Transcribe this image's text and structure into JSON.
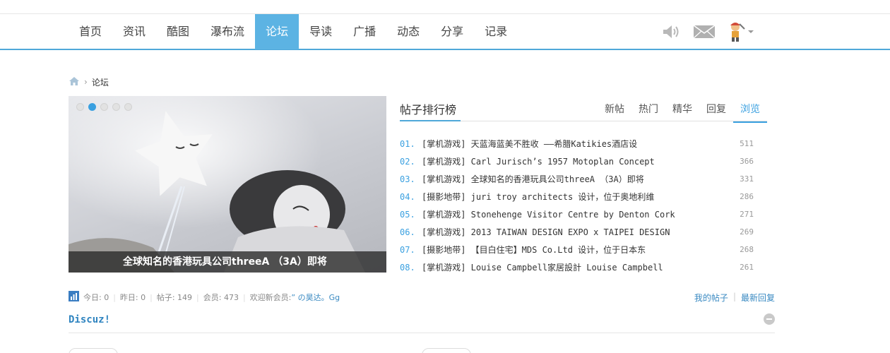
{
  "nav": {
    "items": [
      "首页",
      "资讯",
      "酷图",
      "瀑布流",
      "论坛",
      "导读",
      "广播",
      "动态",
      "分享",
      "记录"
    ],
    "active": "论坛",
    "icons": [
      "speaker-icon",
      "mail-icon",
      "user-avatar-icon",
      "caret-down-icon"
    ]
  },
  "breadcrumb": {
    "current": "论坛",
    "separator": "›"
  },
  "slider": {
    "dots": 5,
    "active_dot": 2,
    "caption": "全球知名的香港玩具公司threeA （3A）即将"
  },
  "rank": {
    "title": "帖子排行榜",
    "tabs": [
      "新帖",
      "热门",
      "精华",
      "回复",
      "浏览"
    ],
    "active_tab": "浏览",
    "rows": [
      {
        "num": "01.",
        "text": "[掌机游戏] 天蓝海蓝美不胜收 ——希腊Katikies酒店设",
        "count": "511"
      },
      {
        "num": "02.",
        "text": "[掌机游戏] Carl Jurisch’s 1957 Motoplan Concept",
        "count": "366"
      },
      {
        "num": "03.",
        "text": "[掌机游戏] 全球知名的香港玩具公司threeA （3A）即将",
        "count": "331"
      },
      {
        "num": "04.",
        "text": "[摄影地带] juri troy architects 设计，位于奥地利维",
        "count": "286"
      },
      {
        "num": "05.",
        "text": "[掌机游戏] Stonehenge Visitor Centre by Denton Cork",
        "count": "271"
      },
      {
        "num": "06.",
        "text": "[掌机游戏] 2013 TAIWAN DESIGN EXPO x TAIPEI DESIGN",
        "count": "269"
      },
      {
        "num": "07.",
        "text": "[摄影地带] 【目白住宅】MDS Co.Ltd 设计，位于日本东",
        "count": "268"
      },
      {
        "num": "08.",
        "text": "[掌机游戏] Louise Campbell家居設計 Louise Campbell",
        "count": "261"
      }
    ]
  },
  "stats": {
    "today": "今日: 0",
    "yesterday": "昨日: 0",
    "posts": "帖子: 149",
    "members": "会员: 473",
    "welcome": "欢迎新会员: ",
    "new_member": "” の昊达。Gg"
  },
  "mylinks": {
    "my_posts": "我的帖子",
    "latest_replies": "最新回复"
  },
  "section": {
    "title": "Discuz!"
  },
  "colors": {
    "accent": "#5cb3e3",
    "link": "#3a8ac2",
    "number": "#3aa0e0"
  }
}
